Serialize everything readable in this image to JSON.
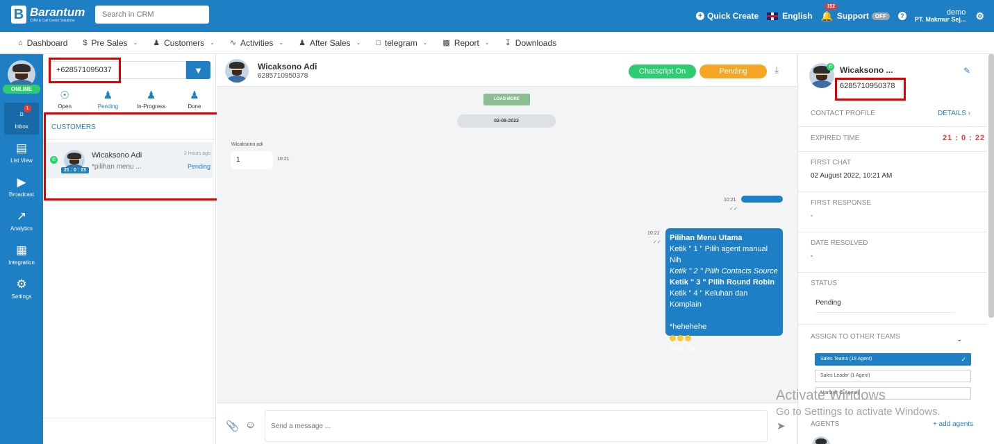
{
  "topbar": {
    "logo_name": "Barantum",
    "logo_tagline": "CRM & Call Center Solutions",
    "crm_search_placeholder": "Search in CRM",
    "quick_create": "Quick Create",
    "language": "English",
    "notification_count": "152",
    "support_label": "Support",
    "support_toggle": "OFF",
    "user_name": "demo",
    "company": "PT. Makmur Sej..."
  },
  "menu": {
    "items": [
      {
        "label": "Dashboard"
      },
      {
        "label": "Pre Sales"
      },
      {
        "label": "Customers"
      },
      {
        "label": "Activities"
      },
      {
        "label": "After Sales"
      },
      {
        "label": "telegram"
      },
      {
        "label": "Report"
      },
      {
        "label": "Downloads"
      }
    ]
  },
  "sidebar": {
    "status": "ONLINE",
    "inbox_badge": "1",
    "items": [
      {
        "label": "Inbox"
      },
      {
        "label": "List View"
      },
      {
        "label": "Broadcast"
      },
      {
        "label": "Analytics"
      },
      {
        "label": "Integration"
      },
      {
        "label": "Settings"
      }
    ]
  },
  "conversations": {
    "search_value": "+628571095037",
    "tabs": [
      {
        "label": "Open"
      },
      {
        "label": "Pending"
      },
      {
        "label": "In-Progress"
      },
      {
        "label": "Done"
      }
    ],
    "section_title": "CUSTOMERS",
    "items": [
      {
        "name": "Wicaksono Adi",
        "preview": "*pilihan menu ...",
        "time": "2 Hours ago",
        "status": "Pending",
        "timer": "21 : 0 : 23"
      }
    ]
  },
  "chat": {
    "contact_name": "Wicaksono Adi",
    "contact_phone": "6285710950378",
    "chatscript_label": "Chatscript On",
    "status_label": "Pending",
    "load_more": "LOAD MORE",
    "date": "02-08-2022",
    "incoming": {
      "sender": "Wicaksono adi",
      "text": "1",
      "time": "10:21"
    },
    "outgoing_time_1": "10:21",
    "outgoing_time_2": "10:21",
    "menu_message": {
      "line1": "Pilihan Menu Utama",
      "line2": "Ketik \" 1 \" Pilih agent manual Nih",
      "line3": "Ketik \" 2 \" Pilih Contacts Source",
      "line4": "Ketik \" 3 \" Pilih Round Robin",
      "line5": "Ketik \" 4 \" Keluhan dan Komplain",
      "line6": "*hehehehe",
      "line7": "Pilih Ya"
    },
    "composer_placeholder": "Send a message ..."
  },
  "details": {
    "name": "Wicaksono ...",
    "phone": "6285710950378",
    "contact_profile_label": "CONTACT PROFILE",
    "details_link": "DETAILS",
    "expired_label": "EXPIRED TIME",
    "expired_value": "21 : 0 : 22",
    "first_chat_label": "FIRST CHAT",
    "first_chat_value": "02 August 2022, 10:21 AM",
    "first_response_label": "FIRST RESPONSE",
    "first_response_value": "-",
    "date_resolved_label": "DATE RESOLVED",
    "date_resolved_value": "-",
    "status_label": "STATUS",
    "status_value": "Pending",
    "assign_label": "ASSIGN TO OTHER TEAMS",
    "teams": [
      {
        "label": "Sales Teams (18 Agent)"
      },
      {
        "label": "Sales Leader (1 Agent)"
      },
      {
        "label": "Manajer (2 Agent)"
      }
    ],
    "agents_label": "AGENTS",
    "add_agents": "+ add agents"
  },
  "watermark": {
    "line1": "Activate Windows",
    "line2": "Go to Settings to activate Windows."
  },
  "colors": {
    "primary": "#1f7fc4",
    "online": "#2ecc71",
    "pending": "#f5a623",
    "alert": "#e53935",
    "highlight_box": "#e00000"
  }
}
